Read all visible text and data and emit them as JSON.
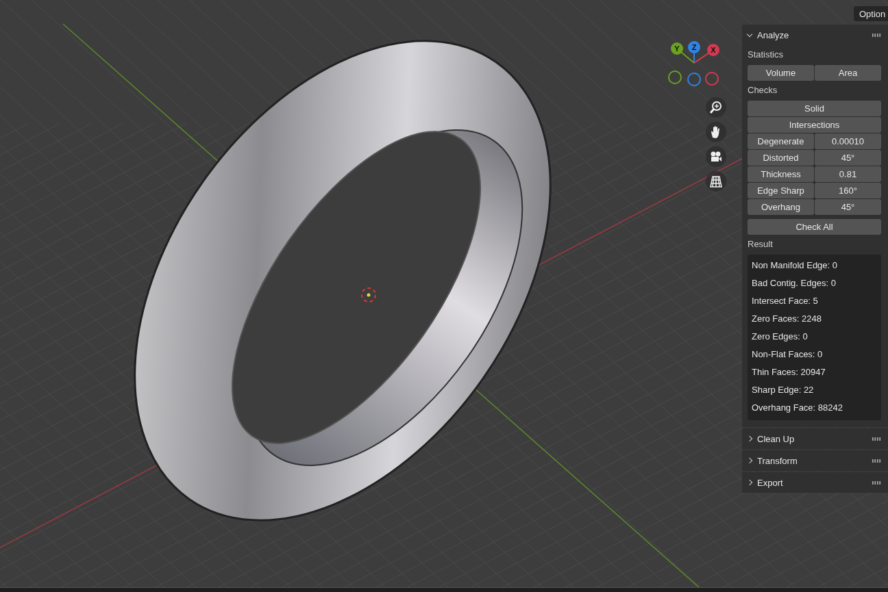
{
  "header": {
    "options_tab": "Option"
  },
  "gizmo": {
    "axes": [
      {
        "label": "Y",
        "color": "#6ba121"
      },
      {
        "label": "Z",
        "color": "#2f84e3"
      },
      {
        "label": "X",
        "color": "#d23a53"
      }
    ]
  },
  "panels": [
    {
      "title": "Analyze",
      "expanded": true,
      "statistics": {
        "heading": "Statistics",
        "buttons": [
          "Volume",
          "Area"
        ]
      },
      "checks": {
        "heading": "Checks",
        "rows": [
          {
            "kind": "button",
            "label": "Solid"
          },
          {
            "kind": "button",
            "label": "Intersections"
          },
          {
            "kind": "setting",
            "label": "Degenerate",
            "value": "0.00010"
          },
          {
            "kind": "setting",
            "label": "Distorted",
            "value": "45°"
          },
          {
            "kind": "setting",
            "label": "Thickness",
            "value": "0.81"
          },
          {
            "kind": "setting",
            "label": "Edge Sharp",
            "value": "160°"
          },
          {
            "kind": "setting",
            "label": "Overhang",
            "value": "45°"
          }
        ],
        "check_all": "Check All"
      },
      "result": {
        "heading": "Result",
        "lines": [
          "Non Manifold Edge: 0",
          "Bad Contig. Edges: 0",
          "Intersect Face: 5",
          "Zero Faces: 2248",
          "Zero Edges: 0",
          "Non-Flat Faces: 0",
          "Thin Faces: 20947",
          "Sharp Edge: 22",
          "Overhang Face: 88242"
        ]
      }
    },
    {
      "title": "Clean Up",
      "expanded": false
    },
    {
      "title": "Transform",
      "expanded": false
    },
    {
      "title": "Export",
      "expanded": false
    }
  ]
}
